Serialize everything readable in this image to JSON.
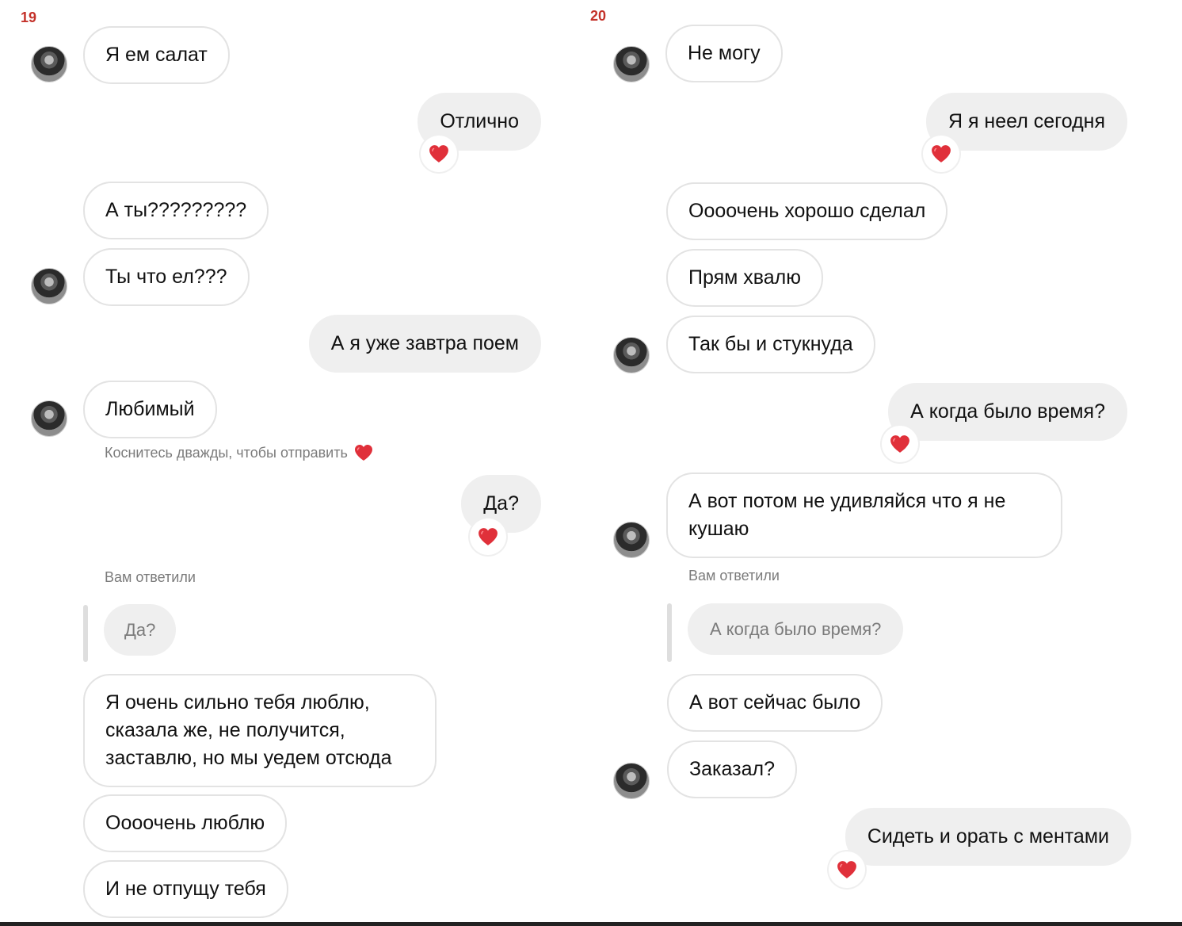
{
  "left": {
    "page_number": "19",
    "messages": [
      {
        "text": "Я ем салат"
      },
      {
        "text": "Отлично"
      },
      {
        "text": "А ты?????????"
      },
      {
        "text": "Ты что ел???"
      },
      {
        "text": "А я уже завтра поем"
      },
      {
        "text": "Любимый"
      },
      {
        "text": "Да?"
      },
      {
        "text": "Я очень сильно тебя люблю, сказала же, не получится, заставлю, но мы уедем отсюда"
      },
      {
        "text": "Оооочень люблю"
      },
      {
        "text": "И не отпущу тебя"
      }
    ],
    "double_tap_hint": "Коснитесь дважды, чтобы отправить",
    "reply_caption": "Вам ответили",
    "quoted_text": "Да?"
  },
  "right": {
    "page_number": "20",
    "messages": [
      {
        "text": "Не могу"
      },
      {
        "text": "Я я неел сегодня"
      },
      {
        "text": "Оооочень хорошо сделал"
      },
      {
        "text": "Прям хвалю"
      },
      {
        "text": "Так бы и стукнуда"
      },
      {
        "text": "А когда было время?"
      },
      {
        "text": "А вот потом не удивляйся что я не кушаю"
      },
      {
        "text": "А вот сейчас было"
      },
      {
        "text": "Заказал?"
      },
      {
        "text": "Сидеть и орать с ментами"
      }
    ],
    "reply_caption": "Вам ответили",
    "quoted_text": "А когда было время?"
  },
  "colors": {
    "heart": "#e0303a",
    "page_number": "#c4322a",
    "incoming_border": "#e3e3e3",
    "outgoing_bg": "#efefef",
    "caption": "#7b7b7b"
  },
  "icons": {
    "reaction": "heart-icon",
    "avatar": "avatar"
  }
}
